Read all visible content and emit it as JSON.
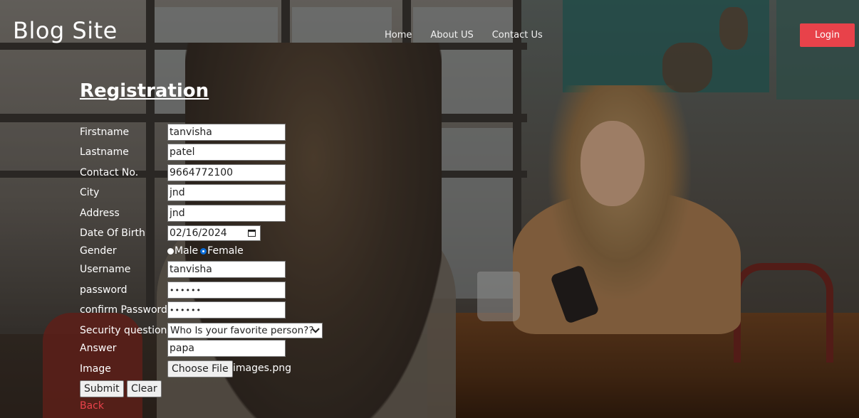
{
  "header": {
    "logo": "Blog Site",
    "nav": [
      "Home",
      "About US",
      "Contact Us"
    ],
    "login_label": "Login"
  },
  "form": {
    "title": "Registration",
    "fields": {
      "firstname": {
        "label": "Firstname",
        "value": "tanvisha"
      },
      "lastname": {
        "label": "Lastname",
        "value": "patel"
      },
      "contact": {
        "label": "Contact No.",
        "value": "9664772100"
      },
      "city": {
        "label": "City",
        "value": "jnd"
      },
      "address": {
        "label": "Address",
        "value": "jnd"
      },
      "dob": {
        "label": "Date Of Birth",
        "value": "02/16/2024"
      },
      "gender": {
        "label": "Gender",
        "options": [
          "Male",
          "Female"
        ],
        "selected": "Female"
      },
      "username": {
        "label": "Username",
        "value": "tanvisha"
      },
      "password": {
        "label": "password",
        "value": "••••••"
      },
      "confirm_password": {
        "label": "confirm Password",
        "value": "••••••"
      },
      "security_question": {
        "label": "Security question",
        "value": "Who Is your favorite person??"
      },
      "answer": {
        "label": "Answer",
        "value": "papa"
      },
      "image": {
        "label": "Image",
        "button": "Choose File",
        "filename": "images.png"
      }
    },
    "submit_label": "Submit",
    "clear_label": "Clear",
    "back_label": "Back"
  },
  "colors": {
    "accent": "#e8424a",
    "radio_selected": "#0b6dd8"
  }
}
